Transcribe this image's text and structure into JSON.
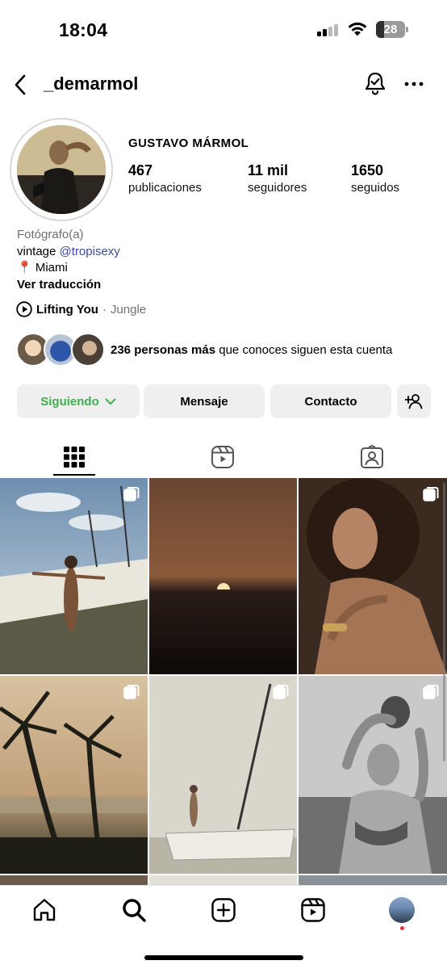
{
  "status_bar": {
    "time": "18:04",
    "battery": "28",
    "battery_level": 0.28
  },
  "header": {
    "username": "_demarmol",
    "back_icon": "chevron-left-icon",
    "bell_icon": "bell-check-icon",
    "more_icon": "ellipsis-icon"
  },
  "profile": {
    "display_name": "GUSTAVO MÁRMOL",
    "stats": [
      {
        "value": "467",
        "label": "publicaciones"
      },
      {
        "value": "11 mil",
        "label": "seguidores"
      },
      {
        "value": "1650",
        "label": "seguidos"
      }
    ]
  },
  "bio": {
    "category": "Fotógrafo(a)",
    "line1_prefix": "vintage ",
    "mention": "@tropisexy",
    "location_pin": "📍",
    "location": "Miami",
    "translate": "Ver traducción"
  },
  "music": {
    "song": "Lifting You",
    "separator": "·",
    "artist": "Jungle"
  },
  "mutual": {
    "bold": "236 personas más",
    "rest": " que conoces siguen esta cuenta"
  },
  "actions": {
    "following": "Siguiendo",
    "message": "Mensaje",
    "contact": "Contacto"
  },
  "tabs": [
    {
      "icon": "grid-icon",
      "active": true
    },
    {
      "icon": "reels-icon",
      "active": false
    },
    {
      "icon": "tagged-icon",
      "active": false
    }
  ],
  "grid": [
    {
      "subject": "woman-on-sailboat-photo",
      "multi": true
    },
    {
      "subject": "sunset-photo",
      "multi": false
    },
    {
      "subject": "curly-hair-portrait-photo",
      "multi": true
    },
    {
      "subject": "palm-trees-photo",
      "multi": true
    },
    {
      "subject": "sailboat-photo",
      "multi": true
    },
    {
      "subject": "bikini-coconut-photo",
      "multi": true
    }
  ],
  "bottom_nav": [
    "home-icon",
    "search-icon",
    "create-icon",
    "reels-icon",
    "profile-avatar"
  ]
}
